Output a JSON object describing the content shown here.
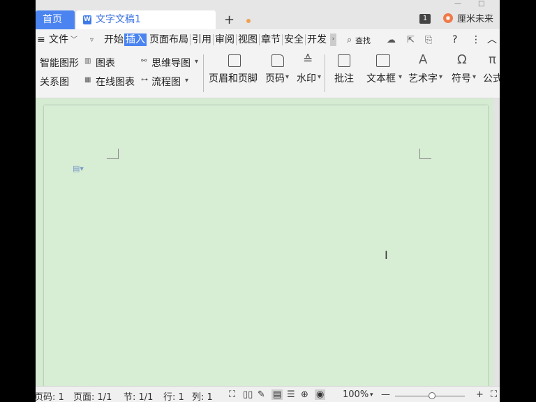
{
  "tabs": {
    "home": "首页",
    "doc_icon": "W",
    "doc_title": "文字文稿1",
    "new_tab": "+"
  },
  "titlebar": {
    "badge": "1",
    "user_name": "厘米未来"
  },
  "menu": {
    "hamburger": "≡",
    "file": "文件",
    "items": [
      "开始",
      "插入",
      "页面布局",
      "引用",
      "审阅",
      "视图",
      "章节",
      "安全",
      "开发"
    ],
    "active": "插入",
    "search": "查找",
    "help": "?",
    "more": "⋮",
    "collapse": "︿"
  },
  "ribbon": {
    "smart_graphic": "智能图形",
    "chart": "图表",
    "mind_map": "思维导图",
    "relation": "关系图",
    "online_chart": "在线图表",
    "flowchart": "流程图",
    "header_footer": "页眉和页脚",
    "page_number": "页码",
    "watermark": "水印",
    "comment": "批注",
    "textbox": "文本框",
    "word_art": "艺术字",
    "symbol": "符号",
    "formula": "公式"
  },
  "statusbar": {
    "page_code": "页码: 1",
    "page": "页面: 1/1",
    "section": "节: 1/1",
    "line": "行: 1",
    "column": "列: 1",
    "zoom": "100%",
    "zoom_minus": "—",
    "zoom_plus": "+"
  },
  "colors": {
    "accent": "#4b84f0",
    "document_bg": "#d5ebd2"
  },
  "zoom_level": 100
}
